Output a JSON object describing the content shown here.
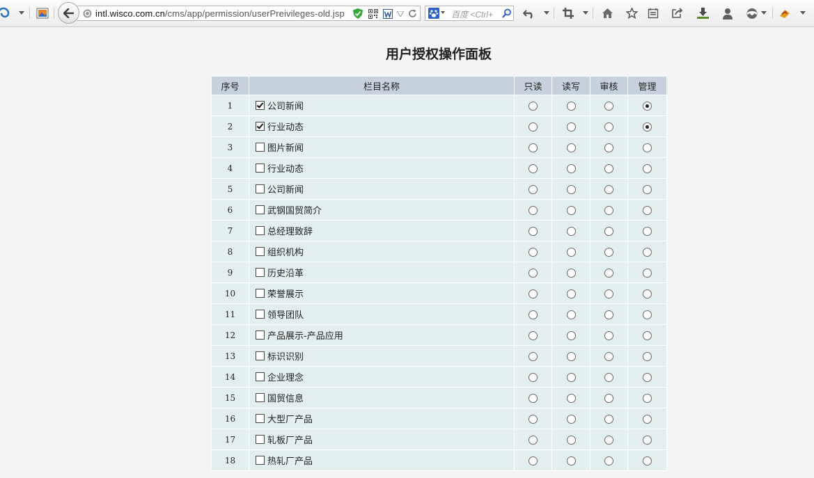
{
  "browser": {
    "url_host": "intl.wisco.com.cn",
    "url_path": "/cms/app/permission/userPreivileges-old.jsp",
    "search_placeholder": "百度 <Ctrl+"
  },
  "page": {
    "title": "用户授权操作面板"
  },
  "table": {
    "headers": {
      "num": "序号",
      "name": "栏目名称",
      "read": "只读",
      "write": "读写",
      "audit": "审核",
      "manage": "管理"
    },
    "rows": [
      {
        "num": "1",
        "name": "公司新闻",
        "checked": true,
        "perm": "manage"
      },
      {
        "num": "2",
        "name": "行业动态",
        "checked": true,
        "perm": "manage"
      },
      {
        "num": "3",
        "name": "图片新闻",
        "checked": false,
        "perm": ""
      },
      {
        "num": "4",
        "name": "行业动态",
        "checked": false,
        "perm": ""
      },
      {
        "num": "5",
        "name": "公司新闻",
        "checked": false,
        "perm": ""
      },
      {
        "num": "6",
        "name": "武钢国贸简介",
        "checked": false,
        "perm": ""
      },
      {
        "num": "7",
        "name": "总经理致辞",
        "checked": false,
        "perm": ""
      },
      {
        "num": "8",
        "name": "组织机构",
        "checked": false,
        "perm": ""
      },
      {
        "num": "9",
        "name": "历史沿革",
        "checked": false,
        "perm": ""
      },
      {
        "num": "10",
        "name": "荣誉展示",
        "checked": false,
        "perm": ""
      },
      {
        "num": "11",
        "name": "领导团队",
        "checked": false,
        "perm": ""
      },
      {
        "num": "12",
        "name": "产品展示-产品应用",
        "checked": false,
        "perm": ""
      },
      {
        "num": "13",
        "name": "标识识别",
        "checked": false,
        "perm": ""
      },
      {
        "num": "14",
        "name": "企业理念",
        "checked": false,
        "perm": ""
      },
      {
        "num": "15",
        "name": "国贸信息",
        "checked": false,
        "perm": ""
      },
      {
        "num": "16",
        "name": "大型厂产品",
        "checked": false,
        "perm": ""
      },
      {
        "num": "17",
        "name": "轧板厂产品",
        "checked": false,
        "perm": ""
      },
      {
        "num": "18",
        "name": "热轧厂产品",
        "checked": false,
        "perm": ""
      }
    ]
  }
}
